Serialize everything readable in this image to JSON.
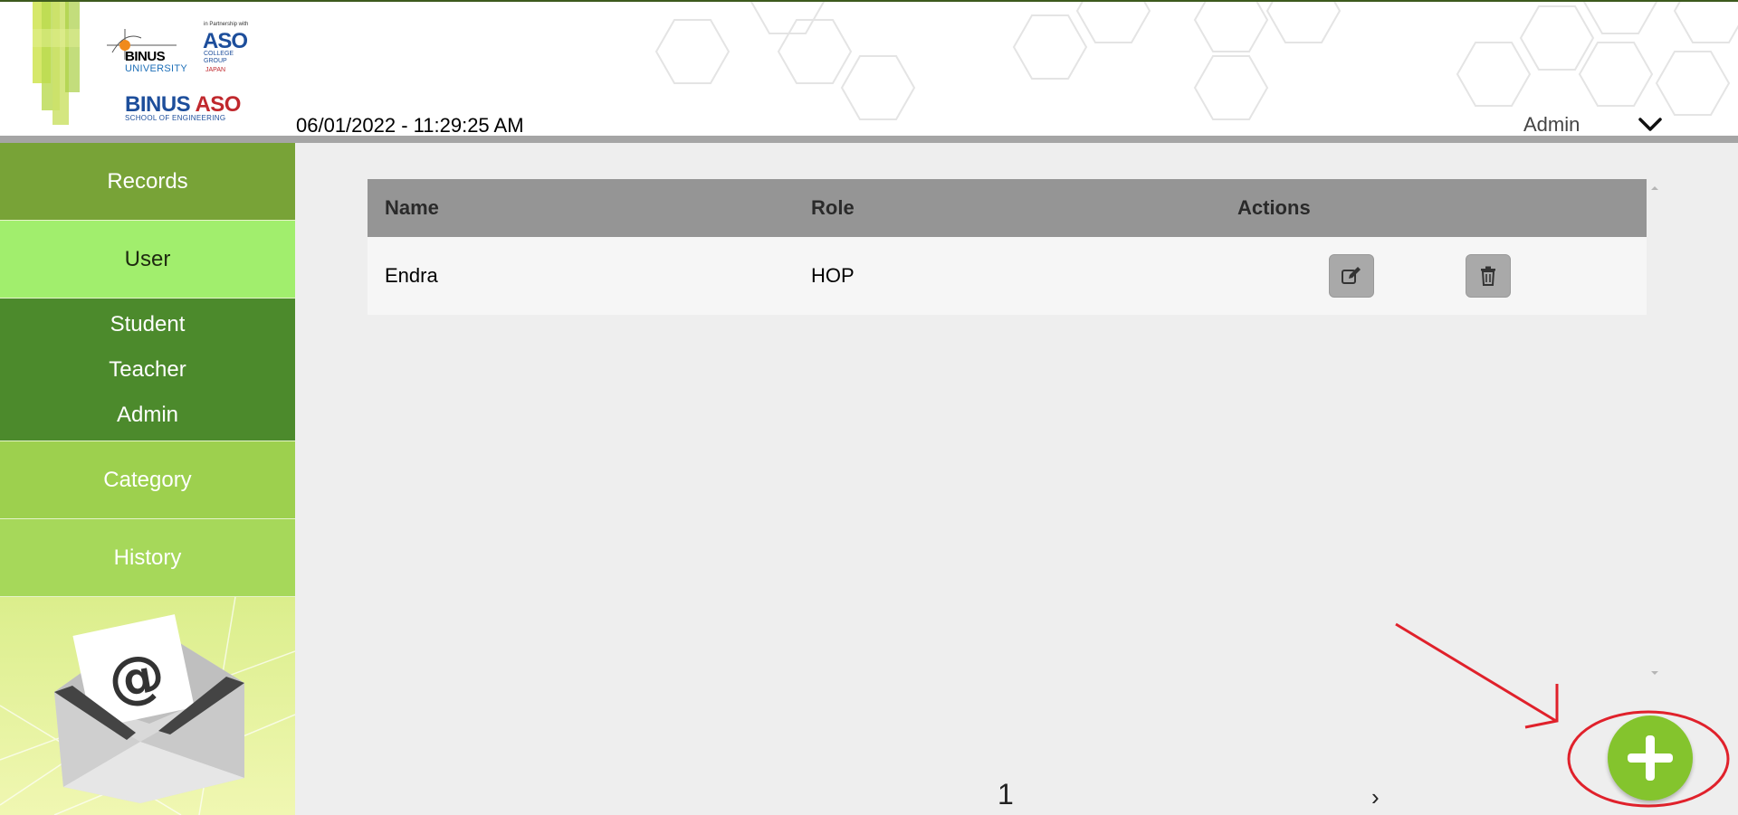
{
  "header": {
    "logo_binus": "BINUS",
    "logo_university": "UNIVERSITY",
    "logo_partnership": "in Partnership with",
    "logo_aso": "ASO",
    "logo_aso_college": "COLLEGE GROUP",
    "logo_aso_japan": "JAPAN",
    "logo_bas_binus": "BINUS",
    "logo_bas_aso": "ASO",
    "logo_bas_sub": "SCHOOL OF ENGINEERING",
    "datetime": "06/01/2022 - 11:29:25 AM",
    "user_label": "Admin"
  },
  "sidebar": {
    "records": "Records",
    "user": "User",
    "sub_items": [
      "Student",
      "Teacher",
      "Admin"
    ],
    "category": "Category",
    "history": "History"
  },
  "table": {
    "columns": [
      "Name",
      "Role",
      "Actions"
    ],
    "rows": [
      {
        "name": "Endra",
        "role": "HOP"
      }
    ]
  },
  "pager": {
    "current": "1",
    "next": "›"
  },
  "colors": {
    "primary_green": "#84c42d",
    "records_bg": "#78a337",
    "user_active_bg": "#a1ee6d",
    "submenu_bg": "#4c8a2c",
    "table_header_bg": "#959595",
    "annotation_red": "#e0212b"
  },
  "icons": {
    "edit": "edit-icon",
    "delete": "trash-icon",
    "add": "plus-icon",
    "dropdown": "chevron-down-icon"
  }
}
